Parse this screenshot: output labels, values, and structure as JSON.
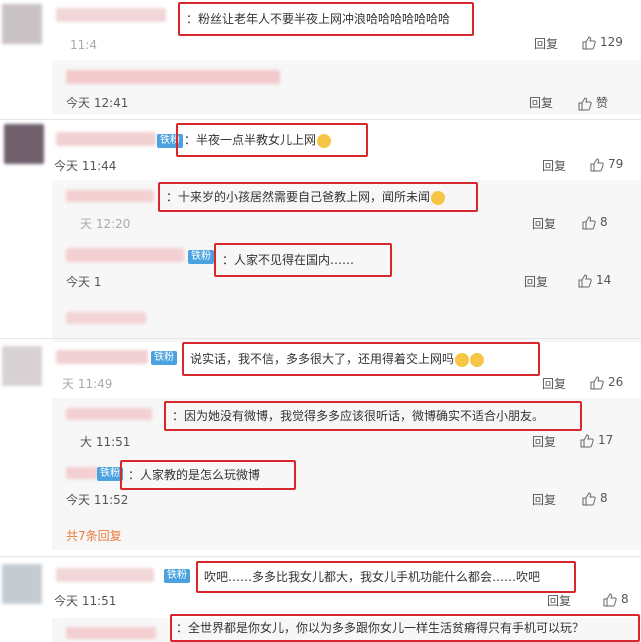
{
  "colors": {
    "highlight": "#d9262c",
    "badge": "#4aa3df",
    "more_link": "#e87d3e"
  },
  "comments": [
    {
      "text": "：粉丝让老年人不要半夜上网冲浪哈哈哈哈哈哈哈",
      "time": "11:4",
      "reply": "回复",
      "likes": "129"
    },
    {
      "text": "",
      "time": "今天 12:41",
      "reply": "回复",
      "likes": "赞"
    },
    {
      "badge": "铁粉",
      "text": "：半夜一点半教女儿上网",
      "emoji": "thumbs-up",
      "time": "今天 11:44",
      "reply": "回复",
      "likes": "79"
    },
    {
      "text": "：十来岁的小孩居然需要自己爸教上网，闻所未闻",
      "emoji": "face",
      "time": "天 12:20",
      "reply": "回复",
      "likes": "8"
    },
    {
      "badge": "铁粉",
      "text": "：人家不见得在国内……",
      "time": "今天 1",
      "reply": "回复",
      "likes": "14"
    },
    {
      "badge": "铁粉",
      "text": "说实话，我不信，多多很大了，还用得着交上网吗",
      "time": "天 11:49",
      "reply": "回复",
      "likes": "26"
    },
    {
      "text": "：因为她没有微博，我觉得多多应该很听话，微博确实不适合小朋友。",
      "time": "大 11:51",
      "reply": "回复",
      "likes": "17"
    },
    {
      "badge": "铁粉",
      "text": "：人家教的是怎么玩微博",
      "time": "今天 11:52",
      "reply": "回复",
      "likes": "8"
    },
    {
      "more": "共7条回复"
    },
    {
      "badge": "铁粉",
      "text": "吹吧……多多比我女儿都大，我女儿手机功能什么都会……吹吧",
      "time": "今天 11:51",
      "reply": "回复",
      "likes": "8"
    },
    {
      "text": "：全世界都是你女儿，你以为多多跟你女儿一样生活贫瘠得只有手机可以玩？"
    }
  ]
}
